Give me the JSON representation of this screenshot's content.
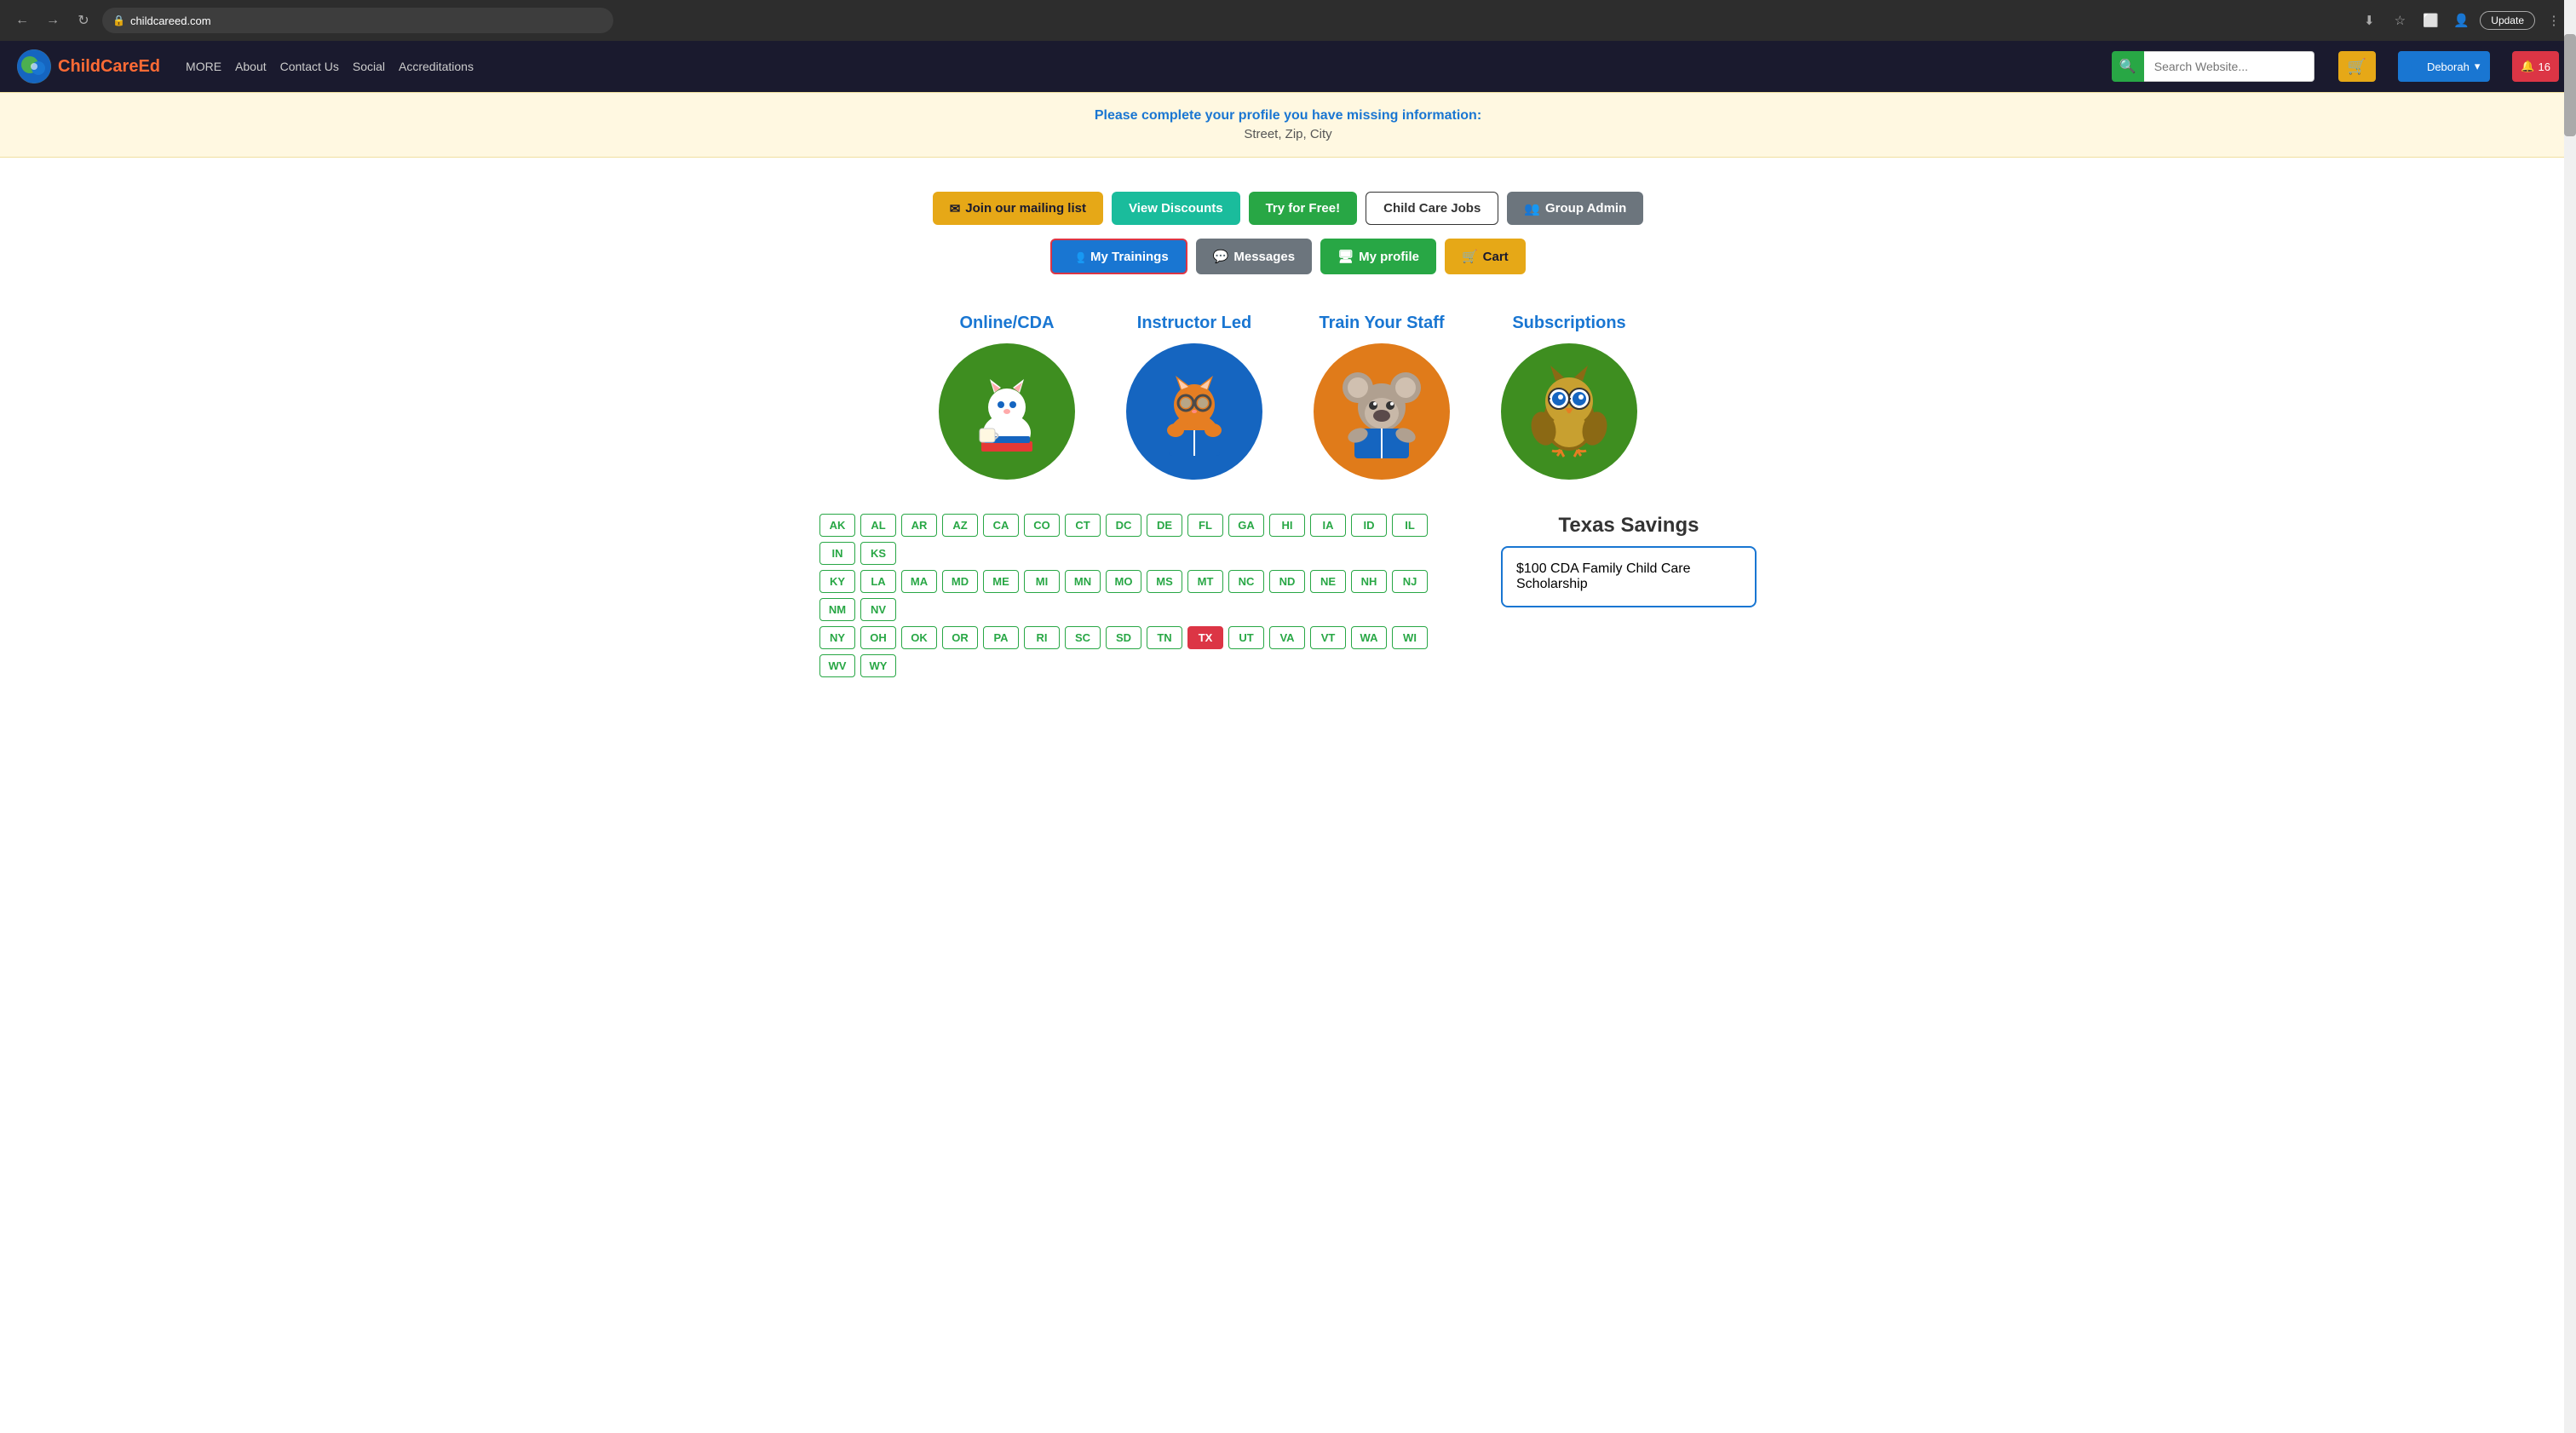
{
  "browser": {
    "url": "childcareed.com",
    "update_label": "Update",
    "lock_icon": "🔒"
  },
  "navbar": {
    "logo_text_main": "ChildCare",
    "logo_text_accent": "Ed",
    "nav_more": "MORE",
    "nav_about": "About",
    "nav_contact": "Contact Us",
    "nav_social": "Social",
    "nav_accreditations": "Accreditations",
    "search_placeholder": "Search Website...",
    "user_name": "Deborah",
    "notif_count": "16"
  },
  "banner": {
    "main_text": "Please complete your profile you have missing information:",
    "sub_text": "Street, Zip, City"
  },
  "buttons_row1": {
    "mailing": "Join our mailing list",
    "discounts": "View Discounts",
    "try_free": "Try for Free!",
    "jobs": "Child Care Jobs",
    "group_admin": "Group Admin"
  },
  "buttons_row2": {
    "trainings": "My Trainings",
    "messages": "Messages",
    "profile": "My profile",
    "cart": "Cart"
  },
  "categories": [
    {
      "title": "Online/CDA",
      "emoji": "🐱",
      "color": "circle-green"
    },
    {
      "title": "Instructor Led",
      "emoji": "🐱",
      "color": "circle-blue"
    },
    {
      "title": "Train Your Staff",
      "emoji": "🐨",
      "color": "circle-orange"
    },
    {
      "title": "Subscriptions",
      "emoji": "🦉",
      "color": "circle-green2"
    }
  ],
  "states": {
    "row1": [
      "AK",
      "AL",
      "AR",
      "AZ",
      "CA",
      "CO",
      "CT",
      "DC",
      "DE",
      "FL",
      "GA",
      "HI",
      "IA",
      "ID",
      "IL",
      "IN",
      "KS"
    ],
    "row2": [
      "KY",
      "LA",
      "MA",
      "MD",
      "ME",
      "MI",
      "MN",
      "MO",
      "MS",
      "MT",
      "NC",
      "ND",
      "NE",
      "NH",
      "NJ",
      "NM",
      "NV"
    ],
    "row3": [
      "NY",
      "OH",
      "OK",
      "OR",
      "PA",
      "RI",
      "SC",
      "SD",
      "TN",
      "TX",
      "UT",
      "VA",
      "VT",
      "WA",
      "WI",
      "WV",
      "WY"
    ],
    "active": "TX"
  },
  "texas_savings": {
    "title": "Texas Savings",
    "description": "$100 CDA Family Child Care Scholarship"
  }
}
